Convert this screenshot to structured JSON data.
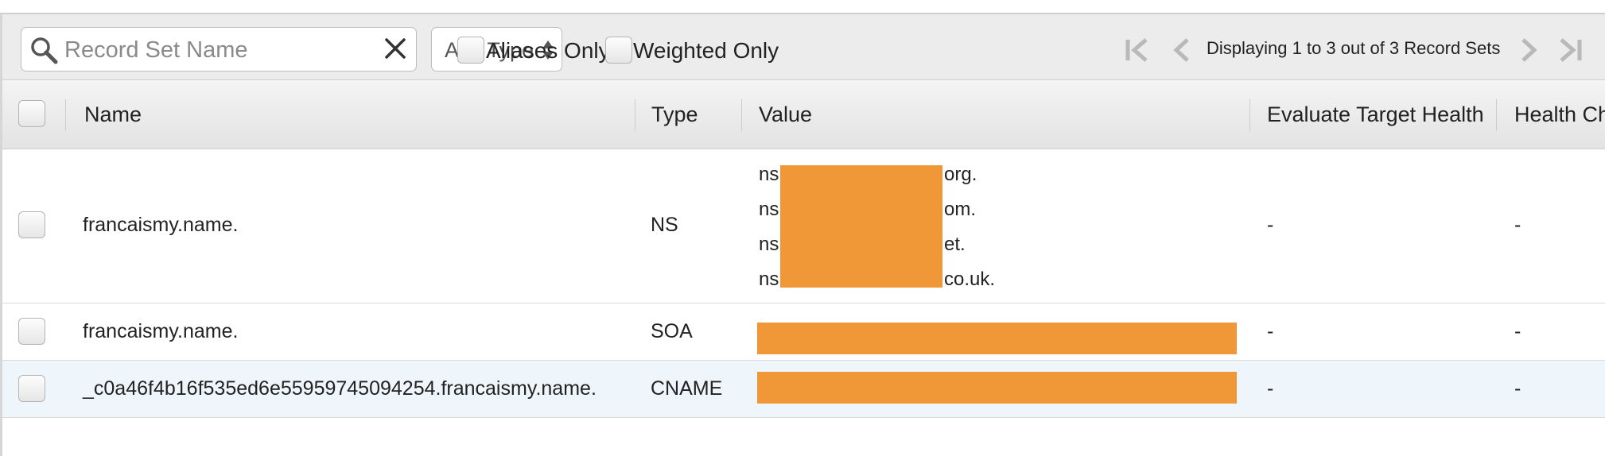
{
  "toolbar": {
    "search_placeholder": "Record Set Name",
    "type_filter": "Any Type",
    "aliases_only_label": "Aliases Only",
    "weighted_only_label": "Weighted Only",
    "pagination_text": "Displaying 1 to 3 out of 3 Record Sets"
  },
  "table": {
    "columns": [
      "Name",
      "Type",
      "Value",
      "Evaluate Target Health",
      "Health Ch"
    ],
    "rows": [
      {
        "name": "francaismy.name.",
        "type": "NS",
        "value_lines": [
          {
            "prefix": "ns",
            "suffix": "org."
          },
          {
            "prefix": "ns",
            "suffix": "om."
          },
          {
            "prefix": "ns",
            "suffix": "et."
          },
          {
            "prefix": "ns",
            "suffix": "co.uk."
          }
        ],
        "evaluate_target_health": "-",
        "health_check": "-"
      },
      {
        "name": "francaismy.name.",
        "type": "SOA",
        "evaluate_target_health": "-",
        "health_check": "-"
      },
      {
        "name": "_c0a46f4b16f535ed6e55959745094254.francaismy.name.",
        "type": "CNAME",
        "evaluate_target_health": "-",
        "health_check": "-"
      }
    ]
  },
  "colors": {
    "redaction": "#f09838",
    "toolbar_bg": "#ececec",
    "selected_row_bg": "#eef5fb",
    "icon_gray": "#b9b9b9"
  },
  "icons": {
    "search": "magnifier-icon",
    "clear": "close-icon",
    "select_arrows": "sort-arrows-icon",
    "first_page": "first-page-icon",
    "prev_page": "prev-page-icon",
    "next_page": "next-page-icon",
    "last_page": "last-page-icon"
  }
}
